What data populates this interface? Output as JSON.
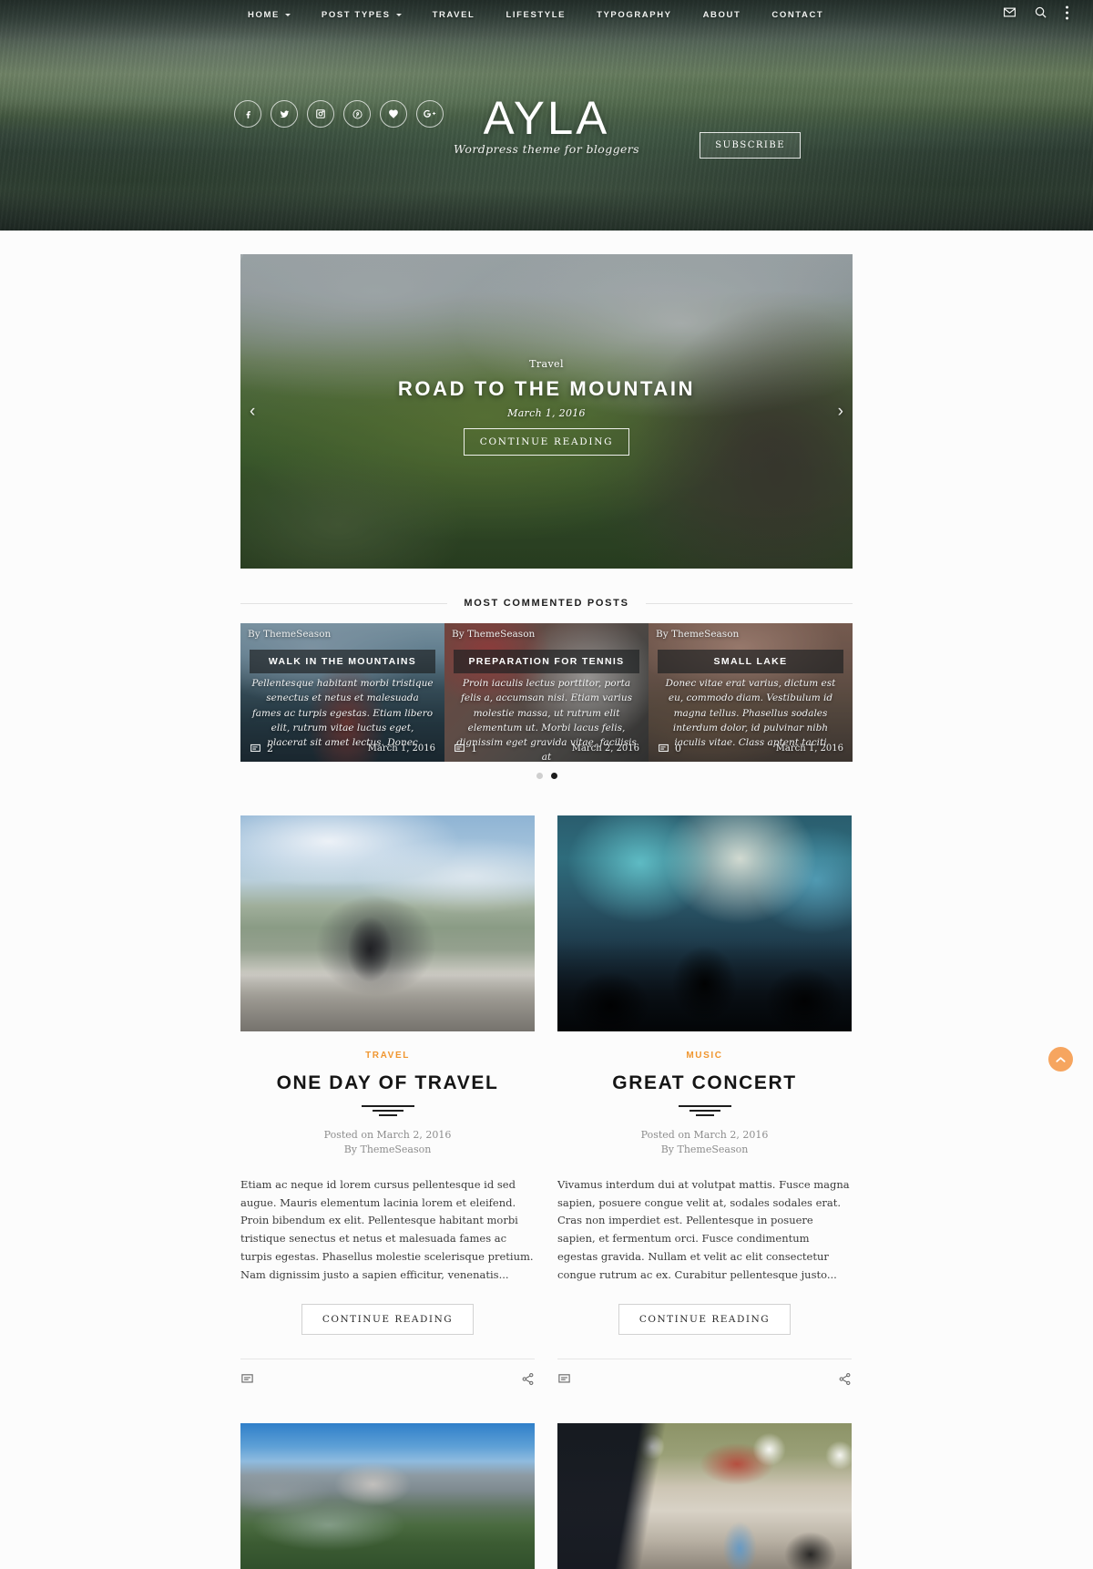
{
  "nav": {
    "items": [
      {
        "label": "HOME",
        "has_dropdown": true
      },
      {
        "label": "POST TYPES",
        "has_dropdown": true
      },
      {
        "label": "TRAVEL",
        "has_dropdown": false
      },
      {
        "label": "LIFESTYLE",
        "has_dropdown": false
      },
      {
        "label": "TYPOGRAPHY",
        "has_dropdown": false
      },
      {
        "label": "ABOUT",
        "has_dropdown": false
      },
      {
        "label": "CONTACT",
        "has_dropdown": false
      }
    ],
    "tools": [
      "mail-icon",
      "search-icon",
      "more-vertical-icon"
    ]
  },
  "brand": {
    "name": "AYLA",
    "tagline": "Wordpress theme for bloggers",
    "subscribe_label": "SUBSCRIBE",
    "social": [
      "facebook-icon",
      "twitter-icon",
      "instagram-icon",
      "pinterest-icon",
      "heart-icon",
      "google-plus-icon"
    ]
  },
  "featured": {
    "category": "Travel",
    "title": "ROAD TO THE MOUNTAIN",
    "date": "March 1, 2016",
    "cta": "CONTINUE READING",
    "prev_arrow": "‹",
    "next_arrow": "›"
  },
  "most_commented": {
    "heading": "MOST COMMENTED POSTS",
    "cards": [
      {
        "author": "By ThemeSeason",
        "title": "WALK IN THE MOUNTAINS",
        "excerpt": "Pellentesque habitant morbi tristique senectus et netus et malesuada fames ac turpis egestas. Etiam libero elit, rutrum vitae luctus eget, placerat sit amet lectus. Donec",
        "comments": "2",
        "date": "March 1, 2016"
      },
      {
        "author": "By ThemeSeason",
        "title": "PREPARATION FOR TENNIS",
        "excerpt": "Proin iaculis lectus porttitor, porta felis a, accumsan nisi. Etiam varius molestie massa, ut rutrum elit elementum ut. Morbi lacus felis, dignissim eget gravida vitae, facilisis at",
        "comments": "1",
        "date": "March 2, 2016"
      },
      {
        "author": "By ThemeSeason",
        "title": "SMALL LAKE",
        "excerpt": "Donec vitae erat varius, dictum est eu, commodo diam. Vestibulum id magna tellus. Phasellus sodales interdum dolor, id pulvinar nibh iaculis vitae. Class aptent taciti",
        "comments": "0",
        "date": "March 1, 2016"
      }
    ],
    "dots": [
      {
        "active": false
      },
      {
        "active": true
      }
    ]
  },
  "posts": [
    {
      "category": "TRAVEL",
      "title": "ONE DAY OF TRAVEL",
      "posted_on": "Posted on March 2, 2016",
      "by": "By ThemeSeason",
      "excerpt": "Etiam ac neque id lorem cursus pellentesque id sed augue. Mauris elementum lacinia lorem et eleifend. Proin bibendum ex elit. Pellentesque habitant morbi tristique senectus et netus et malesuada fames ac turpis egestas. Phasellus molestie scelerisque pretium. Nam dignissim justo a sapien efficitur, venenatis...",
      "cta": "CONTINUE READING",
      "comment_icon": "comment-icon",
      "share_icon": "share-icon"
    },
    {
      "category": "MUSIC",
      "title": "GREAT CONCERT",
      "posted_on": "Posted on March 2, 2016",
      "by": "By ThemeSeason",
      "excerpt": "Vivamus interdum dui at volutpat mattis. Fusce magna sapien, posuere congue velit at, sodales sodales erat. Cras non imperdiet est. Pellentesque in posuere sapien, et fermentum orci. Fusce condimentum egestas gravida. Nullam et velit ac elit consectetur congue rutrum ac ex. Curabitur pellentesque justo...",
      "cta": "CONTINUE READING",
      "comment_icon": "comment-icon",
      "share_icon": "share-icon"
    }
  ],
  "next_row_thumbs": [
    "mountain-thumbnail",
    "office-thumbnail"
  ],
  "scroll_top": {
    "icon": "chevron-up-icon"
  },
  "colors": {
    "accent": "#f0962f",
    "scroll_top_bg": "#f6a55f",
    "text": "#151515"
  }
}
